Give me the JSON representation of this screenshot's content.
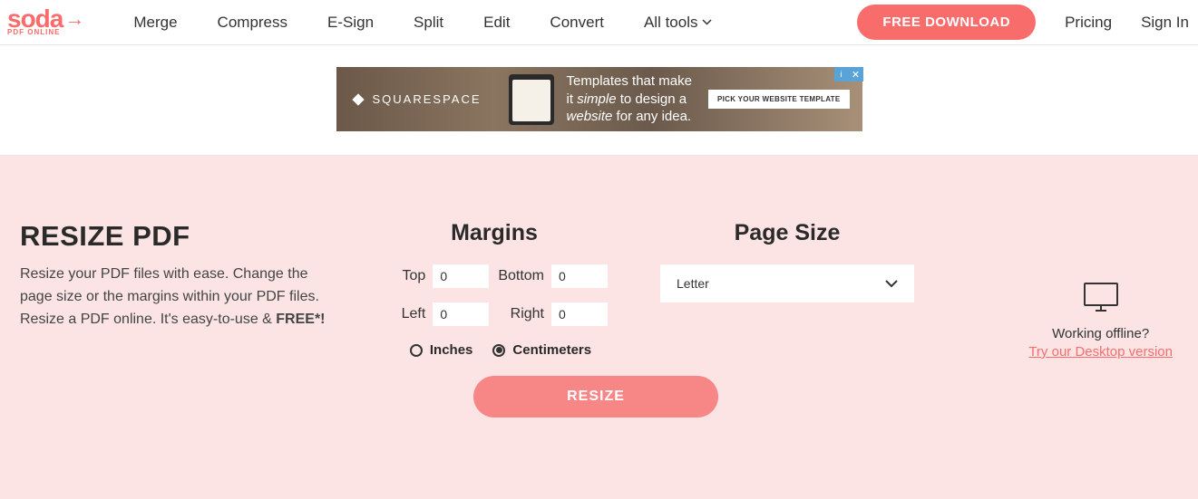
{
  "header": {
    "logo": {
      "main": "soda",
      "sub": "PDF ONLINE"
    },
    "nav": [
      "Merge",
      "Compress",
      "E-Sign",
      "Split",
      "Edit",
      "Convert",
      "All tools"
    ],
    "download_btn": "FREE DOWNLOAD",
    "pricing": "Pricing",
    "signin": "Sign In"
  },
  "ad": {
    "brand": "SQUARESPACE",
    "text_line1": "Templates that make",
    "text_line2_pre": "it ",
    "text_line2_em": "simple",
    "text_line2_post": " to design a",
    "text_line3_em": "website",
    "text_line3_post": " for any idea.",
    "cta": "PICK YOUR WEBSITE TEMPLATE"
  },
  "main": {
    "title": "RESIZE PDF",
    "desc_pre": "Resize your PDF files with ease. Change the page size or the margins within your PDF files. Resize a PDF online. It's easy-to-use & ",
    "desc_strong": "FREE*!",
    "margins": {
      "heading": "Margins",
      "top_label": "Top",
      "top_value": "0",
      "bottom_label": "Bottom",
      "bottom_value": "0",
      "left_label": "Left",
      "left_value": "0",
      "right_label": "Right",
      "right_value": "0",
      "unit_inches": "Inches",
      "unit_cm": "Centimeters"
    },
    "pagesize": {
      "heading": "Page Size",
      "selected": "Letter"
    },
    "resize_btn": "RESIZE",
    "offline": {
      "text": "Working offline?",
      "link": "Try our Desktop version"
    }
  }
}
